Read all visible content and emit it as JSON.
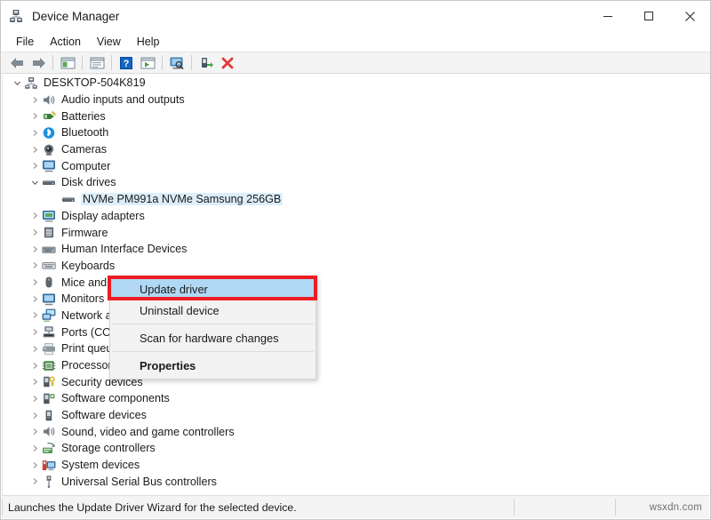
{
  "window": {
    "title": "Device Manager",
    "icon": "device-manager-icon",
    "controls": [
      {
        "name": "minimize-button",
        "glyph": "minimize"
      },
      {
        "name": "maximize-button",
        "glyph": "maximize"
      },
      {
        "name": "close-button",
        "glyph": "close"
      }
    ]
  },
  "menubar": {
    "items": [
      {
        "label": "File"
      },
      {
        "label": "Action"
      },
      {
        "label": "View"
      },
      {
        "label": "Help"
      }
    ]
  },
  "toolbar": {
    "buttons": [
      {
        "name": "back-button",
        "icon": "left-arrow-icon"
      },
      {
        "name": "forward-button",
        "icon": "right-arrow-icon"
      },
      {
        "name": "show-hide-console-tree-button",
        "icon": "console-tree-icon"
      },
      {
        "name": "properties-button",
        "icon": "properties-window-icon"
      },
      {
        "name": "help-button",
        "icon": "question-mark-icon"
      },
      {
        "name": "update-driver-button",
        "icon": "update-driver-icon"
      },
      {
        "name": "scan-hardware-changes-button",
        "icon": "scan-monitor-icon"
      },
      {
        "name": "enable-device-button",
        "icon": "enable-device-icon"
      },
      {
        "name": "uninstall-device-button",
        "icon": "red-x-icon"
      }
    ]
  },
  "tree": {
    "root": {
      "label": "DESKTOP-504K819",
      "icon": "computer-root-icon",
      "expanded": true
    },
    "items": [
      {
        "label": "Audio inputs and outputs",
        "icon": "speaker-icon",
        "level": 1,
        "expanded": false
      },
      {
        "label": "Batteries",
        "icon": "battery-icon",
        "level": 1,
        "expanded": false
      },
      {
        "label": "Bluetooth",
        "icon": "bluetooth-icon",
        "level": 1,
        "expanded": false
      },
      {
        "label": "Cameras",
        "icon": "camera-icon",
        "level": 1,
        "expanded": false
      },
      {
        "label": "Computer",
        "icon": "monitor-icon",
        "level": 1,
        "expanded": false
      },
      {
        "label": "Disk drives",
        "icon": "disk-drive-icon",
        "level": 1,
        "expanded": true
      },
      {
        "label": "NVMe PM991a NVMe Samsung 256GB",
        "icon": "disk-drive-icon",
        "level": 2,
        "expanded": null,
        "selected": true
      },
      {
        "label": "Display adapters",
        "icon": "display-adapter-icon",
        "level": 1,
        "expanded": false
      },
      {
        "label": "Firmware",
        "icon": "firmware-icon",
        "level": 1,
        "expanded": false
      },
      {
        "label": "Human Interface Devices",
        "icon": "hid-icon",
        "level": 1,
        "expanded": false
      },
      {
        "label": "Keyboards",
        "icon": "keyboard-icon",
        "level": 1,
        "expanded": false
      },
      {
        "label": "Mice and other pointing devices",
        "icon": "mouse-icon",
        "level": 1,
        "expanded": false
      },
      {
        "label": "Monitors",
        "icon": "monitor-icon",
        "level": 1,
        "expanded": false
      },
      {
        "label": "Network adapters",
        "icon": "network-adapter-icon",
        "level": 1,
        "expanded": false
      },
      {
        "label": "Ports (COM & LPT)",
        "icon": "port-icon",
        "level": 1,
        "expanded": false
      },
      {
        "label": "Print queues",
        "icon": "printer-icon",
        "level": 1,
        "expanded": false
      },
      {
        "label": "Processors",
        "icon": "processor-icon",
        "level": 1,
        "expanded": false
      },
      {
        "label": "Security devices",
        "icon": "security-device-icon",
        "level": 1,
        "expanded": false
      },
      {
        "label": "Software components",
        "icon": "software-component-icon",
        "level": 1,
        "expanded": false
      },
      {
        "label": "Software devices",
        "icon": "software-device-icon",
        "level": 1,
        "expanded": false
      },
      {
        "label": "Sound, video and game controllers",
        "icon": "speaker-icon",
        "level": 1,
        "expanded": false
      },
      {
        "label": "Storage controllers",
        "icon": "storage-controller-icon",
        "level": 1,
        "expanded": false
      },
      {
        "label": "System devices",
        "icon": "system-device-icon",
        "level": 1,
        "expanded": false
      },
      {
        "label": "Universal Serial Bus controllers",
        "icon": "usb-icon",
        "level": 1,
        "expanded": false
      }
    ]
  },
  "context_menu": {
    "items": [
      {
        "label": "Update driver",
        "highlighted": true,
        "bold": false
      },
      {
        "label": "Uninstall device",
        "highlighted": false,
        "bold": false
      },
      {
        "label": "Scan for hardware changes",
        "highlighted": false,
        "bold": false
      },
      {
        "label": "Properties",
        "highlighted": false,
        "bold": true
      }
    ]
  },
  "annotation": {
    "highlight_border_color": "#ed1c24",
    "highlight_fill_color": "#b0d8f5"
  },
  "statusbar": {
    "message": "Launches the Update Driver Wizard for the selected device.",
    "watermark": "wsxdn.com"
  }
}
